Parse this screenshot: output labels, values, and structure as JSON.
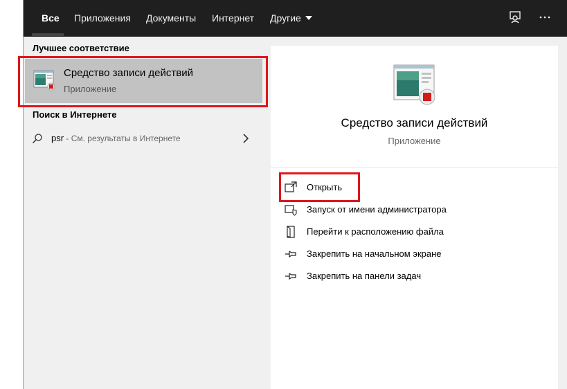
{
  "tabs": [
    {
      "label": "Все",
      "active": true
    },
    {
      "label": "Приложения"
    },
    {
      "label": "Документы"
    },
    {
      "label": "Интернет"
    },
    {
      "label": "Другие"
    }
  ],
  "topbar_icons": [
    "feedback-icon",
    "more-icon"
  ],
  "left": {
    "best_match_title": "Лучшее соответствие",
    "best_match": {
      "name": "Средство записи действий",
      "type": "Приложение",
      "icon": "steps-recorder-icon"
    },
    "web_title": "Поиск в Интернете",
    "web_query": "psr",
    "web_hint": " - См. результаты в Интернете"
  },
  "right": {
    "app_name": "Средство записи действий",
    "app_type": "Приложение",
    "actions": [
      {
        "label": "Открыть",
        "icon": "open-icon"
      },
      {
        "label": "Запуск от имени администратора",
        "icon": "run-as-admin-icon"
      },
      {
        "label": "Перейти к расположению файла",
        "icon": "file-location-icon"
      },
      {
        "label": "Закрепить на начальном экране",
        "icon": "pin-start-icon"
      },
      {
        "label": "Закрепить на панели задач",
        "icon": "pin-taskbar-icon"
      }
    ]
  },
  "colors": {
    "highlight": "#e0161b",
    "topbar": "#1f1f1f",
    "selected": "#c2c2c2"
  }
}
